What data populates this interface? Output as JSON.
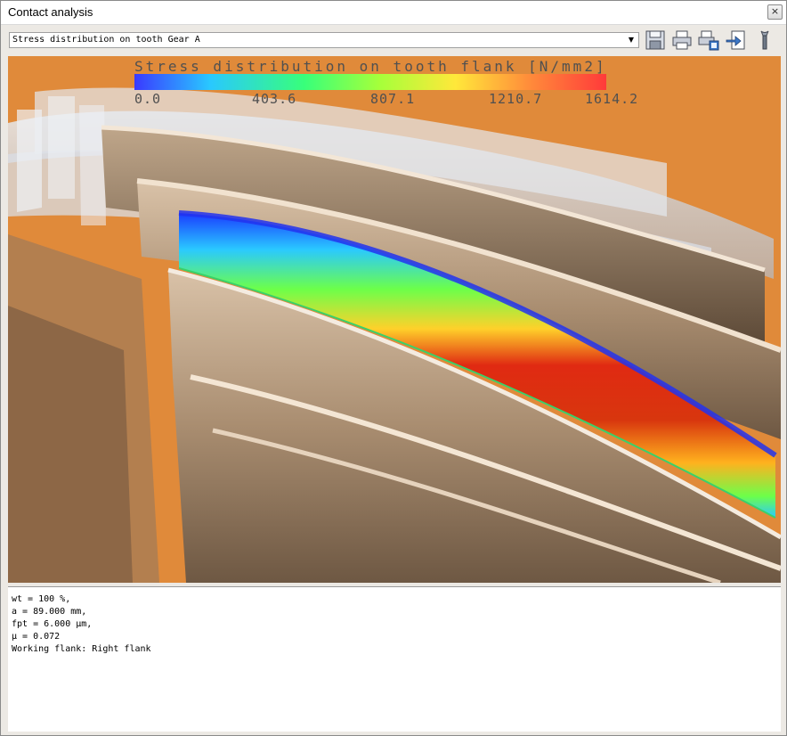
{
  "window": {
    "title": "Contact analysis",
    "close_glyph": "×"
  },
  "toolbar": {
    "selected_view": "Stress distribution on tooth Gear A",
    "icons": [
      "save-icon",
      "print-icon",
      "print-preview-icon",
      "export-icon",
      "settings-wrench-icon"
    ]
  },
  "plot": {
    "legend_title": "Stress distribution on tooth flank [N/mm2]",
    "legend_ticks": [
      "0.0",
      "403.6",
      "807.1",
      "1210.7",
      "1614.2"
    ],
    "colormap": [
      "#3a3aff",
      "#29c8ff",
      "#38ff7a",
      "#a6ff3a",
      "#ffe83a",
      "#ff8a3a",
      "#ff3a3a"
    ],
    "background_color": "#e08a3a"
  },
  "info": {
    "lines": [
      "wt = 100 %,",
      "a = 89.000 mm,",
      "fpt = 6.000 µm,",
      "µ = 0.072",
      "Working flank: Right flank"
    ]
  }
}
